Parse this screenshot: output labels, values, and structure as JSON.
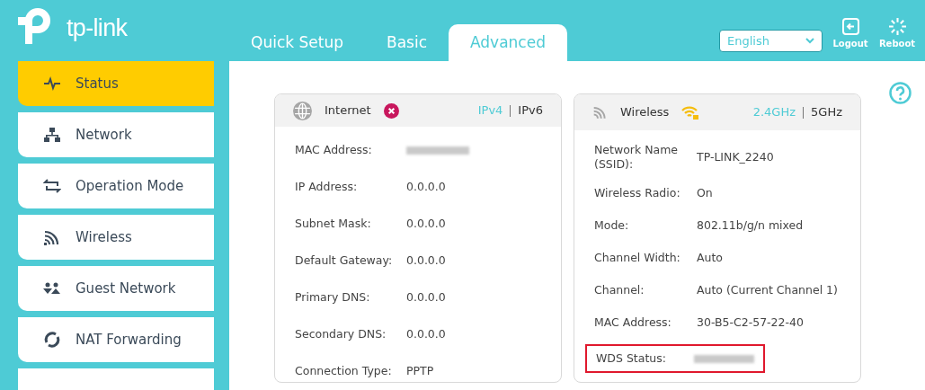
{
  "brand": {
    "name": "tp-link"
  },
  "tabs": [
    {
      "label": "Quick Setup",
      "selected": false
    },
    {
      "label": "Basic",
      "selected": false
    },
    {
      "label": "Advanced",
      "selected": true
    }
  ],
  "language": {
    "value": "English"
  },
  "header_actions": [
    {
      "kind": "logout",
      "label": "Logout"
    },
    {
      "kind": "reboot",
      "label": "Reboot"
    }
  ],
  "sidebar": {
    "items": [
      {
        "kind": "status",
        "label": "Status",
        "selected": true
      },
      {
        "kind": "network",
        "label": "Network",
        "selected": false
      },
      {
        "kind": "mode",
        "label": "Operation Mode",
        "selected": false
      },
      {
        "kind": "wireless",
        "label": "Wireless",
        "selected": false
      },
      {
        "kind": "guest",
        "label": "Guest Network",
        "selected": false
      },
      {
        "kind": "nat",
        "label": "NAT Forwarding",
        "selected": false
      },
      {
        "selected": false
      }
    ]
  },
  "cards": [
    {
      "kind": "internet",
      "title": "Internet",
      "connected": false,
      "switch": [
        {
          "label": "IPv4",
          "selected": true
        },
        {
          "label": "IPv6",
          "selected": false
        }
      ],
      "rows": [
        {
          "label": "MAC Address:",
          "redacted": true
        },
        {
          "label": "IP Address:",
          "value": "0.0.0.0"
        },
        {
          "label": "Subnet Mask:",
          "value": "0.0.0.0"
        },
        {
          "label": "Default Gateway:",
          "value": "0.0.0.0"
        },
        {
          "label": "Primary DNS:",
          "value": "0.0.0.0"
        },
        {
          "label": "Secondary DNS:",
          "value": "0.0.0.0"
        },
        {
          "label": "Connection Type:",
          "value": "PPTP"
        }
      ]
    },
    {
      "kind": "wireless",
      "title": "Wireless",
      "connected": true,
      "switch": [
        {
          "label": "2.4GHz",
          "selected": true
        },
        {
          "label": "5GHz",
          "selected": false
        }
      ],
      "rows": [
        {
          "label": "Network Name (SSID):",
          "value": "TP-LINK_2240"
        },
        {
          "label": "Wireless Radio:",
          "value": "On"
        },
        {
          "label": "Mode:",
          "value": "802.11b/g/n mixed"
        },
        {
          "label": "Channel Width:",
          "value": "Auto"
        },
        {
          "label": "Channel:",
          "value": "Auto (Current Channel 1)"
        },
        {
          "label": "MAC Address:",
          "value": "30-B5-C2-57-22-40"
        },
        {
          "label": "WDS Status:",
          "redacted": true,
          "highlighted": true
        }
      ]
    }
  ]
}
